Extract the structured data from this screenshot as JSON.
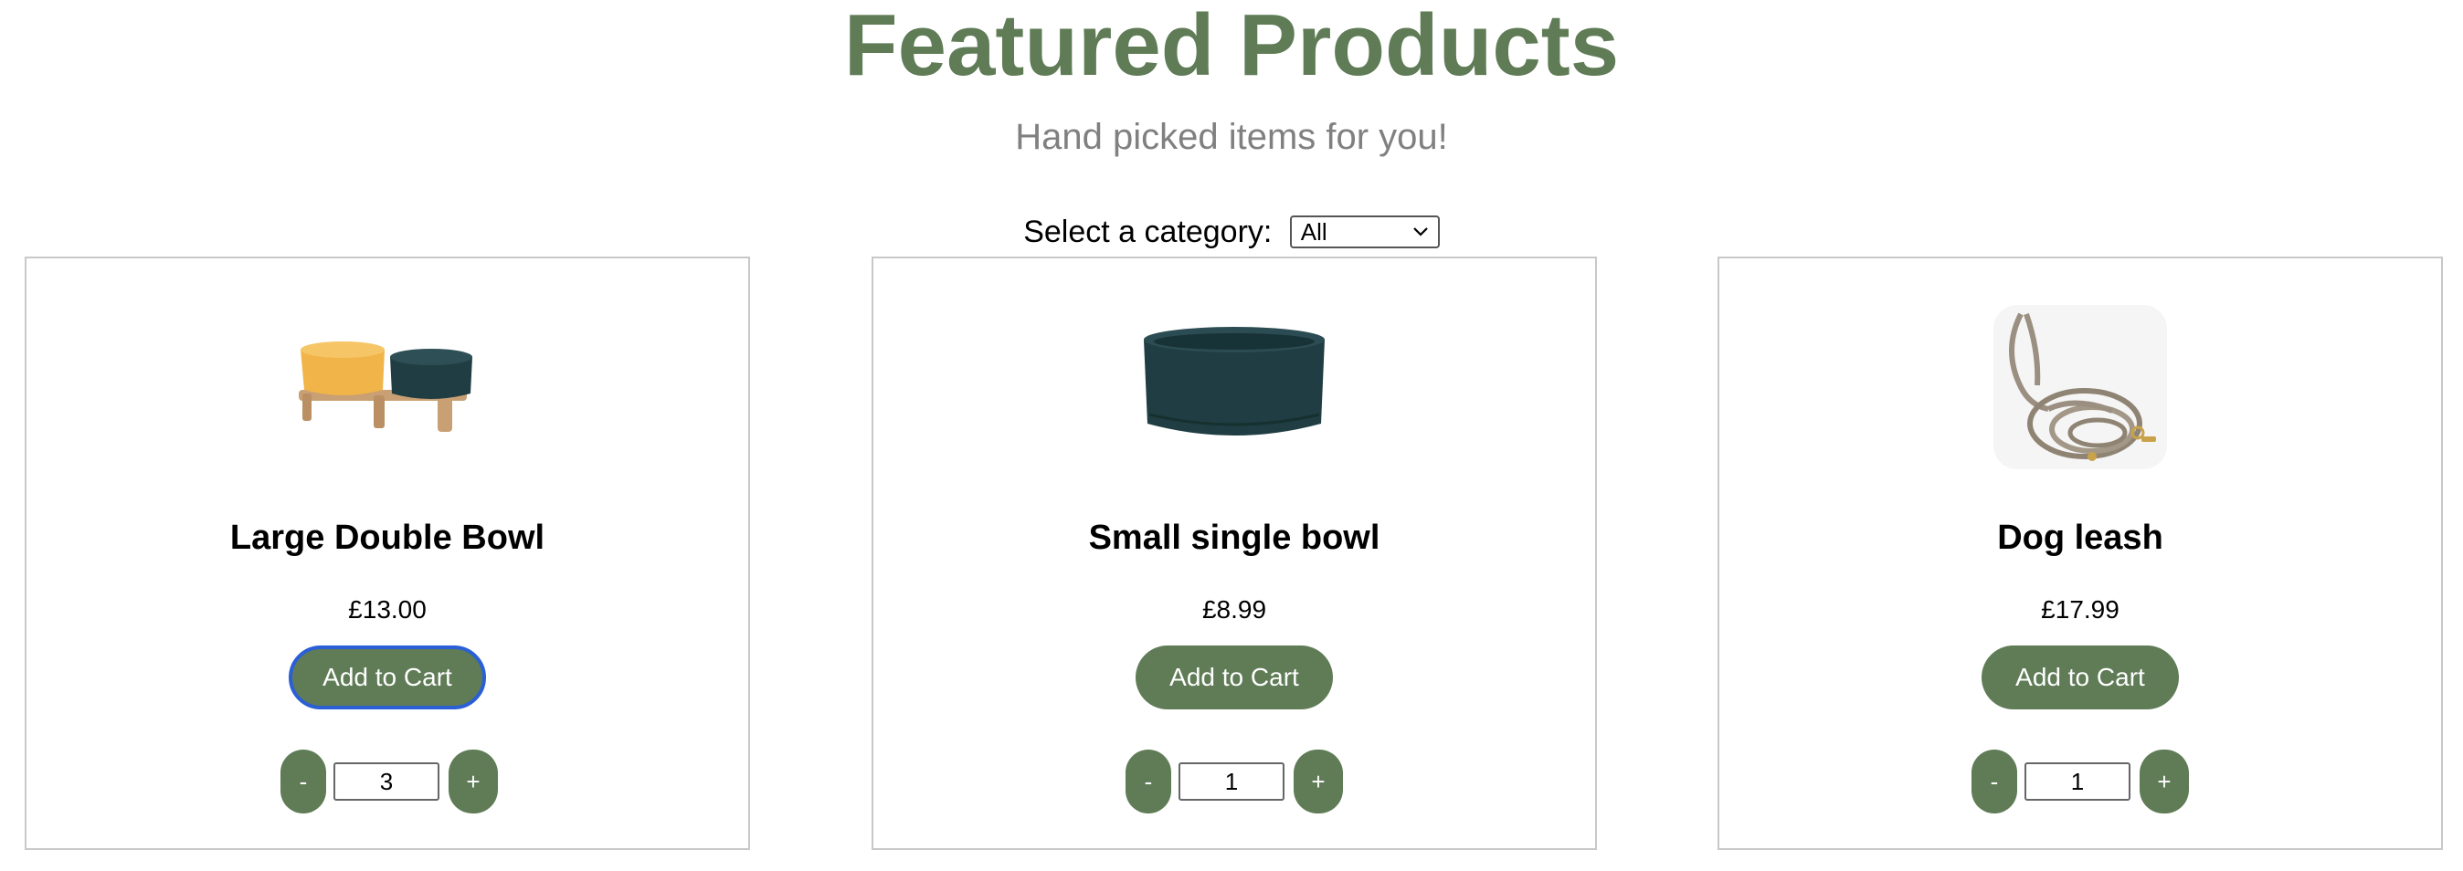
{
  "header": {
    "title": "Featured Products",
    "subtitle": "Hand picked items for you!"
  },
  "filter": {
    "label": "Select a category:",
    "selected": "All"
  },
  "theme": {
    "accent": "#5f7c56",
    "focus_ring": "#2a5fd6",
    "subtitle_color": "#808080"
  },
  "products": [
    {
      "name": "Large Double Bowl",
      "price": "£13.00",
      "add_label": "Add to Cart",
      "qty": "3",
      "minus": "-",
      "plus": "+",
      "image": "double-bowl-image"
    },
    {
      "name": "Small single bowl",
      "price": "£8.99",
      "add_label": "Add to Cart",
      "qty": "1",
      "minus": "-",
      "plus": "+",
      "image": "single-bowl-image"
    },
    {
      "name": "Dog leash",
      "price": "£17.99",
      "add_label": "Add to Cart",
      "qty": "1",
      "minus": "-",
      "plus": "+",
      "image": "dog-leash-image"
    }
  ]
}
